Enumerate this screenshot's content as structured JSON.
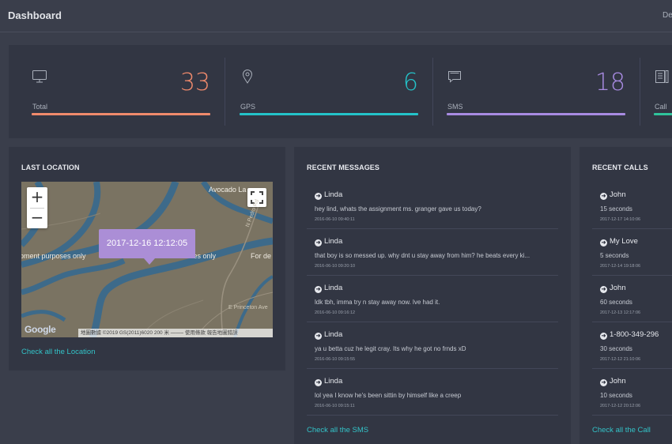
{
  "header": {
    "title": "Dashboard",
    "right_text": "De"
  },
  "stats": [
    {
      "label": "Total",
      "value": "33",
      "icon": "monitor-icon",
      "color": "#f08a6c"
    },
    {
      "label": "GPS",
      "value": "6",
      "icon": "location-pin-icon",
      "color": "#24c3c9"
    },
    {
      "label": "SMS",
      "value": "18",
      "icon": "message-icon",
      "color": "#a88be2"
    },
    {
      "label": "Call",
      "value": "",
      "icon": "call-log-icon",
      "color": "#2fc49b"
    }
  ],
  "location": {
    "title": "LAST LOCATION",
    "tooltip": "2017-12-16 12:12:05",
    "map_labels": {
      "place": "Avocado La",
      "left_text": "pment purposes only",
      "mid_text": "oses only",
      "right_text": "For de",
      "road1": "N Pedro Rd",
      "road2": "E Princeton Ave"
    },
    "map_logo": "Google",
    "map_footer": "地圖數據 ©2019 GS(2011)6020   200 米 ⎯⎯⎯⎯⎯   使用條款   報告地圖錯誤",
    "zoom_in": "+",
    "zoom_out": "−",
    "link": "Check all the Location"
  },
  "messages": {
    "title": "RECENT MESSAGES",
    "items": [
      {
        "name": "Linda",
        "text": "hey lind, whats the assignment ms. granger gave us today?",
        "time": "2016-06-10 09:40:11"
      },
      {
        "name": "Linda",
        "text": "that boy is so messed up. why dnt u stay away from him? he beats every ki...",
        "time": "2016-06-10 09:20:10"
      },
      {
        "name": "Linda",
        "text": "ldk tbh, imma try n stay away now. lve had it.",
        "time": "2016-06-10 09:16:12"
      },
      {
        "name": "Linda",
        "text": "ya u betta cuz he legit cray. Its why he got no frnds xD",
        "time": "2016-06-10 09:15:55"
      },
      {
        "name": "Linda",
        "text": "lol yea I know he's been sittin by himself like a creep",
        "time": "2016-06-10 09:15:11"
      }
    ],
    "link": "Check all the SMS"
  },
  "calls": {
    "title": "RECENT CALLS",
    "items": [
      {
        "name": "John",
        "duration": "15 seconds",
        "time": "2017-12-17 14:10:06"
      },
      {
        "name": "My Love",
        "duration": "5 seconds",
        "time": "2017-12-14 19:18:06"
      },
      {
        "name": "John",
        "duration": "60 seconds",
        "time": "2017-12-13 12:17:06"
      },
      {
        "name": "1-800-349-296",
        "duration": "30 seconds",
        "time": "2017-12-12 21:10:06"
      },
      {
        "name": "John",
        "duration": "10 seconds",
        "time": "2017-12-12 20:12:06"
      }
    ],
    "link": "Check all the Call"
  }
}
